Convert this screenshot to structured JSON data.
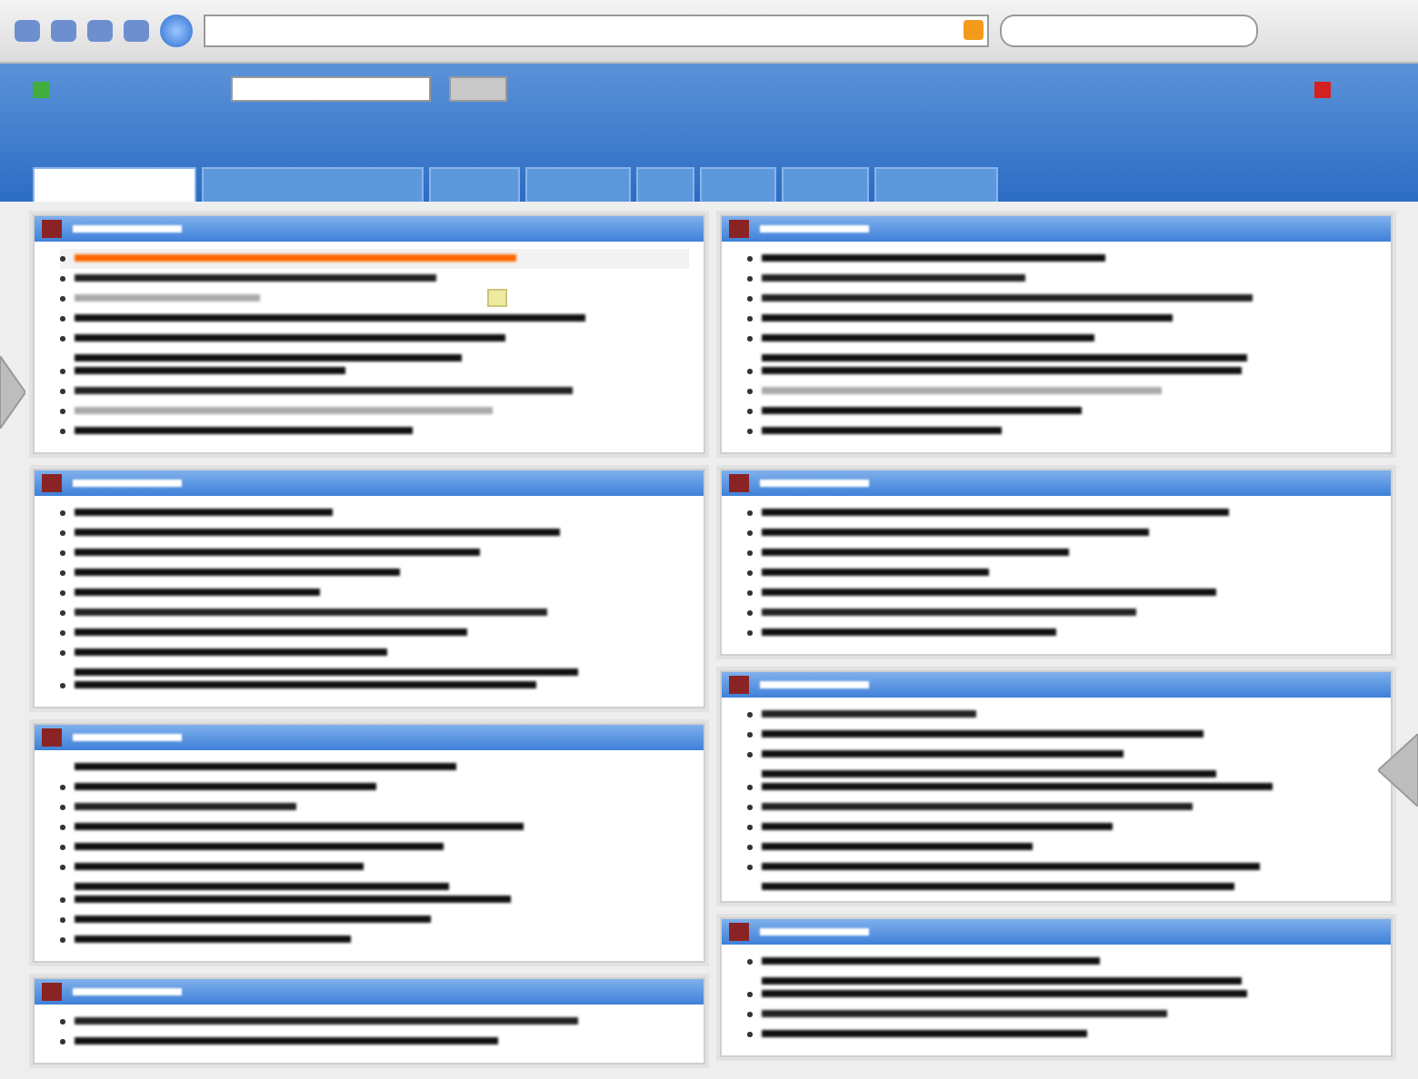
{
  "tabs": [
    {
      "selected": true
    },
    {
      "selected": false
    },
    {
      "selected": false
    },
    {
      "selected": false
    },
    {
      "selected": false
    },
    {
      "selected": false
    },
    {
      "selected": false
    },
    {
      "selected": false
    }
  ],
  "columns": [
    {
      "panels": [
        {
          "items": [
            {
              "color": "#ff6600",
              "highlighted": true
            },
            {
              "color": "#222222"
            },
            {
              "color": "#aaaaaa",
              "note": true
            },
            {
              "color": "#111111"
            },
            {
              "color": "#111111",
              "wrapped": true
            },
            {
              "color": "#111111"
            },
            {
              "color": "#222222"
            },
            {
              "color": "#aaaaaa"
            },
            {
              "color": "#111111"
            }
          ]
        },
        {
          "items": [
            {
              "color": "#111111"
            },
            {
              "color": "#111111"
            },
            {
              "color": "#111111"
            },
            {
              "color": "#111111"
            },
            {
              "color": "#111111"
            },
            {
              "color": "#222222"
            },
            {
              "color": "#111111"
            },
            {
              "color": "#111111",
              "wrapped": true
            },
            {
              "color": "#111111"
            }
          ]
        },
        {
          "items": [
            {
              "color": "#111111",
              "bullet": false
            },
            {
              "color": "#111111"
            },
            {
              "color": "#222222"
            },
            {
              "color": "#111111"
            },
            {
              "color": "#111111"
            },
            {
              "color": "#111111",
              "wrapped": true
            },
            {
              "color": "#111111"
            },
            {
              "color": "#111111"
            },
            {
              "color": "#111111"
            }
          ]
        },
        {
          "items": [
            {
              "color": "#222222"
            },
            {
              "color": "#111111"
            }
          ]
        }
      ]
    },
    {
      "panels": [
        {
          "items": [
            {
              "color": "#111111"
            },
            {
              "color": "#222222"
            },
            {
              "color": "#222222"
            },
            {
              "color": "#111111"
            },
            {
              "color": "#111111",
              "wrapped": true
            },
            {
              "color": "#111111"
            },
            {
              "color": "#aaaaaa"
            },
            {
              "color": "#111111"
            },
            {
              "color": "#111111"
            }
          ]
        },
        {
          "items": [
            {
              "color": "#111111"
            },
            {
              "color": "#111111"
            },
            {
              "color": "#111111"
            },
            {
              "color": "#111111"
            },
            {
              "color": "#111111"
            },
            {
              "color": "#222222"
            },
            {
              "color": "#111111"
            }
          ]
        },
        {
          "items": [
            {
              "color": "#222222"
            },
            {
              "color": "#111111"
            },
            {
              "color": "#111111",
              "wrapped": true
            },
            {
              "color": "#111111"
            },
            {
              "color": "#222222"
            },
            {
              "color": "#111111"
            },
            {
              "color": "#111111"
            },
            {
              "color": "#111111",
              "wrapped": true
            }
          ]
        },
        {
          "items": [
            {
              "color": "#111111",
              "wrapped": true
            },
            {
              "color": "#111111"
            },
            {
              "color": "#222222"
            },
            {
              "color": "#111111"
            }
          ]
        }
      ]
    }
  ]
}
